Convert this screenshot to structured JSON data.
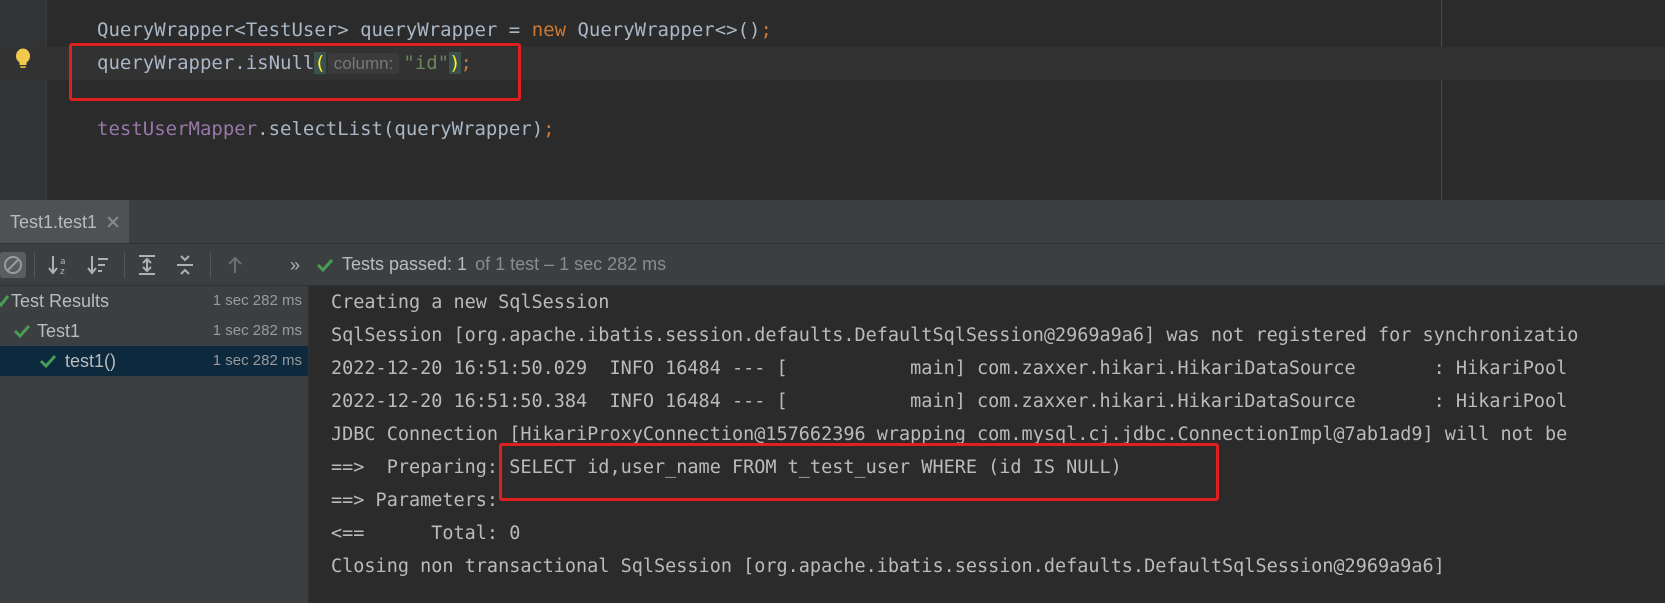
{
  "editor": {
    "lines": [
      {
        "name": "code-line-1",
        "segments": [
          {
            "text": "QueryWrapper<TestUser> queryWrapper = ",
            "cls": ""
          },
          {
            "text": "new",
            "cls": "kw"
          },
          {
            "text": " QueryWrapper<>()",
            "cls": ""
          },
          {
            "text": ";",
            "cls": "kw"
          }
        ]
      },
      {
        "name": "code-line-2",
        "segments": [
          {
            "text": "queryWrapper.isNull",
            "cls": ""
          },
          {
            "text": "(",
            "cls": "paren-hl"
          },
          {
            "text": "column:",
            "cls": "hint"
          },
          {
            "text": "\"id\"",
            "cls": "str"
          },
          {
            "text": ")",
            "cls": "paren-hl"
          },
          {
            "text": ";",
            "cls": "kw"
          }
        ]
      },
      {
        "name": "code-line-3",
        "segments": []
      },
      {
        "name": "code-line-4",
        "segments": [
          {
            "text": "testUserMapper",
            "cls": "field"
          },
          {
            "text": ".selectList(queryWrapper)",
            "cls": ""
          },
          {
            "text": ";",
            "cls": "kw"
          }
        ]
      }
    ]
  },
  "run_tab": {
    "label": "Test1.test1"
  },
  "toolbar": {
    "more": "»",
    "status_passed": "Tests passed: 1",
    "status_rest": "of 1 test – 1 sec 282 ms"
  },
  "tree": {
    "items": [
      {
        "label": "Test Results",
        "time": "1 sec 282 ms"
      },
      {
        "label": "Test1",
        "time": "1 sec 282 ms"
      },
      {
        "label": "test1()",
        "time": "1 sec 282 ms"
      }
    ]
  },
  "console": {
    "lines": [
      "Creating a new SqlSession",
      "SqlSession [org.apache.ibatis.session.defaults.DefaultSqlSession@2969a9a6] was not registered for synchronizatio",
      "2022-12-20 16:51:50.029  INFO 16484 --- [           main] com.zaxxer.hikari.HikariDataSource       : HikariPool",
      "2022-12-20 16:51:50.384  INFO 16484 --- [           main] com.zaxxer.hikari.HikariDataSource       : HikariPool",
      "JDBC Connection [HikariProxyConnection@157662396 wrapping com.mysql.cj.jdbc.ConnectionImpl@7ab1ad9] will not be",
      "==>  Preparing: SELECT id,user_name FROM t_test_user WHERE (id IS NULL)",
      "==> Parameters: ",
      "<==      Total: 0",
      "Closing non transactional SqlSession [org.apache.ibatis.session.defaults.DefaultSqlSession@2969a9a6]"
    ]
  },
  "colors": {
    "check_green": "#499c54",
    "highlight_box": "#e02020"
  }
}
